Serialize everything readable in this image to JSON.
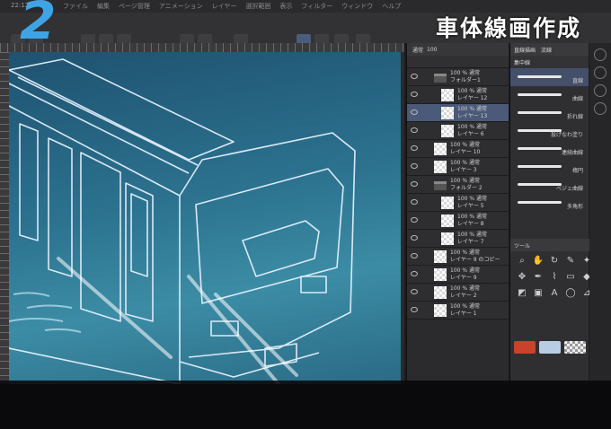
{
  "header": {
    "step_number": "2",
    "step_title": "車体線画作成",
    "clock": "22:12",
    "menu_items": [
      "ファイル",
      "編集",
      "ページ管理",
      "アニメーション",
      "レイヤー",
      "選択範囲",
      "表示",
      "フィルター",
      "ウィンドウ",
      "ヘルプ"
    ]
  },
  "layer_panel": {
    "header_blend": "通常",
    "opacity": "100",
    "layers": [
      {
        "line1": "100 % 通常",
        "line2": "フォルダー1",
        "type": "folder",
        "indent": 0,
        "selected": false
      },
      {
        "line1": "100 % 通常",
        "line2": "レイヤー 12",
        "type": "raster",
        "indent": 1,
        "selected": false
      },
      {
        "line1": "100 % 通常",
        "line2": "レイヤー 13",
        "type": "raster",
        "indent": 1,
        "selected": true
      },
      {
        "line1": "100 % 通常",
        "line2": "レイヤー 6",
        "type": "raster",
        "indent": 1,
        "selected": false
      },
      {
        "line1": "100 % 通常",
        "line2": "レイヤー 10",
        "type": "raster",
        "indent": 0,
        "selected": false
      },
      {
        "line1": "100 % 通常",
        "line2": "レイヤー 3",
        "type": "raster",
        "indent": 0,
        "selected": false
      },
      {
        "line1": "100 % 通常",
        "line2": "フォルダー 2",
        "type": "folder",
        "indent": 0,
        "selected": false
      },
      {
        "line1": "100 % 通常",
        "line2": "レイヤー 5",
        "type": "raster",
        "indent": 1,
        "selected": false
      },
      {
        "line1": "100 % 通常",
        "line2": "レイヤー 8",
        "type": "raster",
        "indent": 1,
        "selected": false
      },
      {
        "line1": "100 % 通常",
        "line2": "レイヤー 7",
        "type": "raster",
        "indent": 1,
        "selected": false
      },
      {
        "line1": "100 % 通常",
        "line2": "レイヤー 9 のコピー",
        "type": "raster",
        "indent": 0,
        "selected": false
      },
      {
        "line1": "100 % 通常",
        "line2": "レイヤー 9",
        "type": "raster",
        "indent": 0,
        "selected": false
      },
      {
        "line1": "100 % 通常",
        "line2": "レイヤー 2",
        "type": "raster",
        "indent": 0,
        "selected": false
      },
      {
        "line1": "100 % 通常",
        "line2": "レイヤー 1",
        "type": "raster",
        "indent": 0,
        "selected": false
      }
    ]
  },
  "brush_panel": {
    "tabs": [
      "直線描画",
      "流線"
    ],
    "group": "集中線",
    "items": [
      {
        "label": "直線",
        "selected": true
      },
      {
        "label": "曲線",
        "selected": false
      },
      {
        "label": "折れ線",
        "selected": false
      },
      {
        "label": "投げなわ塗り",
        "selected": false
      },
      {
        "label": "連続曲線",
        "selected": false
      },
      {
        "label": "楕円",
        "selected": false
      },
      {
        "label": "ベジェ曲線",
        "selected": false
      },
      {
        "label": "多角形",
        "selected": false
      }
    ],
    "tools_tab": "ツール",
    "tool_icons": [
      "magnifier-icon",
      "hand-icon",
      "rotate-icon",
      "eyedropper-icon",
      "magic-wand-icon",
      "move-icon",
      "pen-icon",
      "brush-icon",
      "eraser-icon",
      "fill-icon",
      "gradient-icon",
      "frame-icon",
      "text-icon",
      "balloon-icon",
      "ruler-icon"
    ],
    "main_color": "#c8422c",
    "sub_color": "#b8cce4"
  },
  "colors": {
    "step_number": "#3ea4e6",
    "canvas_top": "#1e5270",
    "canvas_mid": "#3c8ca5",
    "selected_layer": "#4a5a78"
  }
}
